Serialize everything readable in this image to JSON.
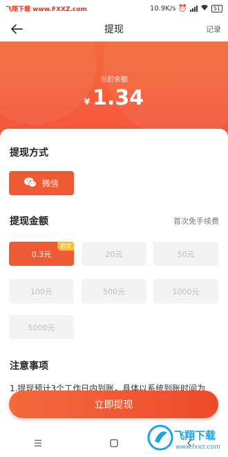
{
  "statusbar": {
    "watermark": "飞翔下载 www.FXXZ.com",
    "speed": "10.9K/s",
    "battery": "51"
  },
  "header": {
    "title": "提现",
    "right_link": "记录"
  },
  "balance": {
    "label": "当前余额",
    "currency": "¥",
    "value": "1.34"
  },
  "method": {
    "title": "提现方式",
    "option_label": "微信"
  },
  "amount": {
    "title": "提现金额",
    "note": "首次免手续费",
    "badge": "首次",
    "options": [
      "0.3元",
      "20元",
      "50元",
      "100元",
      "500元",
      "1000元",
      "5000元"
    ]
  },
  "notice": {
    "title": "注意事项",
    "text": "1.提现预计3个工作日内到账，具体以系统到账时间为"
  },
  "submit_label": "立即提现",
  "logo": {
    "name": "飞翔下载",
    "url": "www.fxxz.com"
  },
  "colors": {
    "accent": "#ef5a36",
    "badge": "#fbc02d"
  }
}
